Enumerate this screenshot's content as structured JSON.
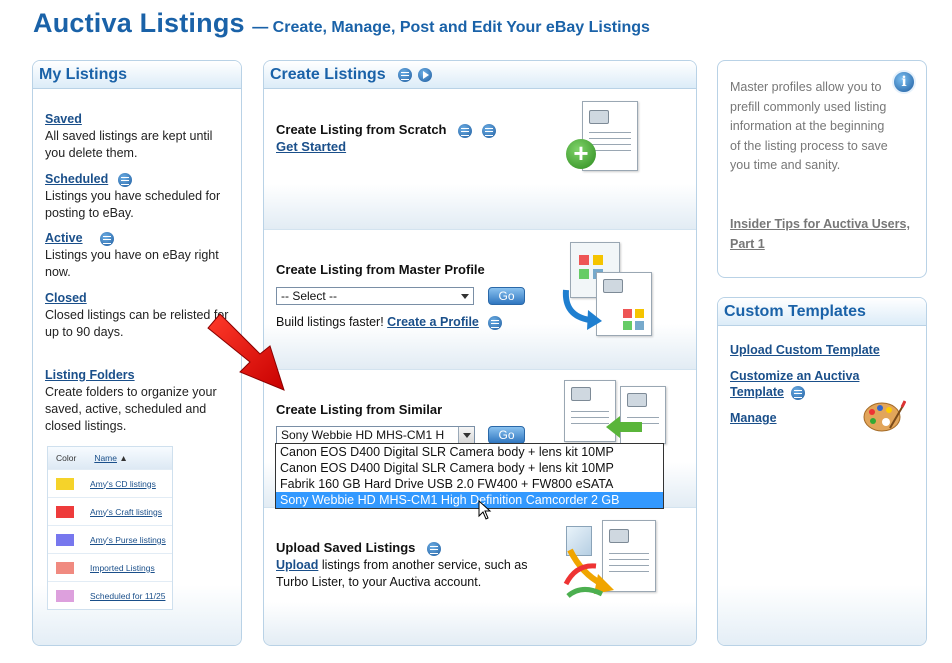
{
  "header": {
    "title": "Auctiva Listings",
    "subtitle": "— Create, Manage, Post and Edit Your eBay Listings"
  },
  "my_listings": {
    "heading": "My Listings",
    "items": [
      {
        "label": "Saved",
        "desc": "All saved listings are kept until you delete them."
      },
      {
        "label": "Scheduled",
        "desc": "Listings you have scheduled for posting to eBay."
      },
      {
        "label": "Active",
        "desc": "Listings you have on eBay right now."
      },
      {
        "label": "Closed",
        "desc": "Closed listings can be relisted for up to 90 days."
      },
      {
        "label": "Listing Folders",
        "desc": "Create folders to organize your saved, active, scheduled and closed listings."
      }
    ],
    "folders_table": {
      "col_color": "Color",
      "col_name": "Name",
      "sort_indicator": "▲",
      "rows": [
        {
          "name": "Amy's CD listings",
          "color": "#f5d32a"
        },
        {
          "name": "Amy's Craft listings",
          "color": "#ee3b3b"
        },
        {
          "name": "Amy's Purse listings",
          "color": "#7777ee"
        },
        {
          "name": "Imported Listings",
          "color": "#f08a80"
        },
        {
          "name": "Scheduled for 11/25",
          "color": "#dda0dd"
        }
      ]
    }
  },
  "create_listings": {
    "heading": "Create Listings",
    "scratch": {
      "title": "Create Listing from Scratch",
      "link": "Get Started"
    },
    "master_profile": {
      "title": "Create Listing from Master Profile",
      "select_value": "-- Select --",
      "go_label": "Go",
      "text_before": "Build listings faster!",
      "link": "Create a Profile"
    },
    "similar": {
      "title": "Create Listing from Similar",
      "select_value": "Sony Webbie HD MHS-CM1 H",
      "go_label": "Go",
      "options": [
        "Canon EOS D400 Digital SLR Camera body + lens kit 10MP",
        "Canon EOS D400 Digital SLR Camera body + lens kit 10MP",
        "Fabrik 160 GB Hard Drive USB 2.0 FW400 + FW800 eSATA",
        "Sony Webbie HD MHS-CM1 High Definition Camcorder 2 GB"
      ],
      "selected_index": 3
    },
    "upload": {
      "title": "Upload Saved Listings",
      "link": "Upload",
      "text": "listings from another service, such as Turbo Lister, to your Auctiva account."
    }
  },
  "info_panel": {
    "text": "Master profiles allow you to prefill commonly used listing information at the beginning of the listing process to save you time and sanity.",
    "link": "Insider Tips for Auctiva Users, Part 1",
    "icon_glyph": "i"
  },
  "custom_templates": {
    "heading": "Custom Templates",
    "links": [
      "Upload Custom Template",
      "Customize an Auctiva Template",
      "Manage"
    ]
  }
}
